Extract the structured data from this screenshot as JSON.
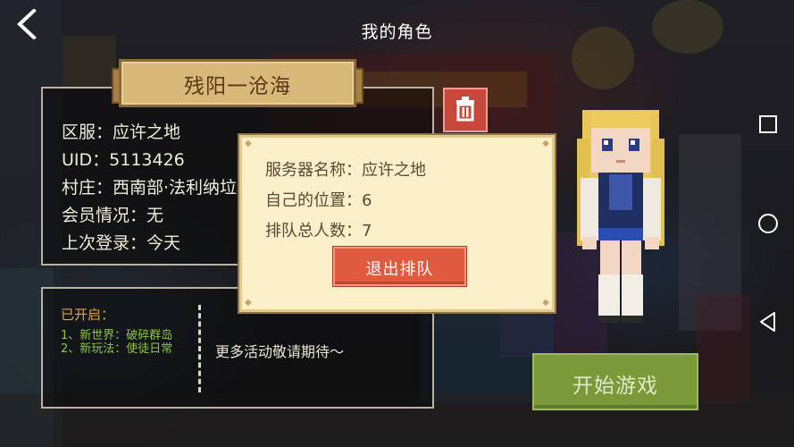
{
  "header": {
    "title": "我的角色"
  },
  "character": {
    "name": "残阳一沧海",
    "server_line": "区服：应许之地",
    "uid_line": "UID：5113426",
    "village_line": "村庄：西南部·法利纳垃",
    "membership_line": "会员情况：无",
    "last_login_line": "上次登录：今天"
  },
  "events": {
    "title": "已开启：",
    "items": [
      "1、新世界：破碎群岛",
      "2、新玩法：使徒日常"
    ],
    "more": "更多活动敬请期待～"
  },
  "start_button": {
    "label": "开始游戏"
  },
  "queue_dialog": {
    "server_line": "服务器名称：应许之地",
    "position_line": "自己的位置：6",
    "total_line": "排队总人数：7",
    "quit_label": "退出排队"
  },
  "icons": {
    "back": "back-chevron-icon",
    "delete": "trash-icon",
    "nav_recents": "square-icon",
    "nav_home": "circle-icon",
    "nav_back": "triangle-icon"
  },
  "colors": {
    "banner": "#d9b97a",
    "delete_button": "#c8493c",
    "start_button": "#7a9a3a",
    "dialog_bg": "#fbf0c9",
    "quit_button": "#e05a3f",
    "events_title": "#e2a23a",
    "events_items": "#8fc63b"
  }
}
